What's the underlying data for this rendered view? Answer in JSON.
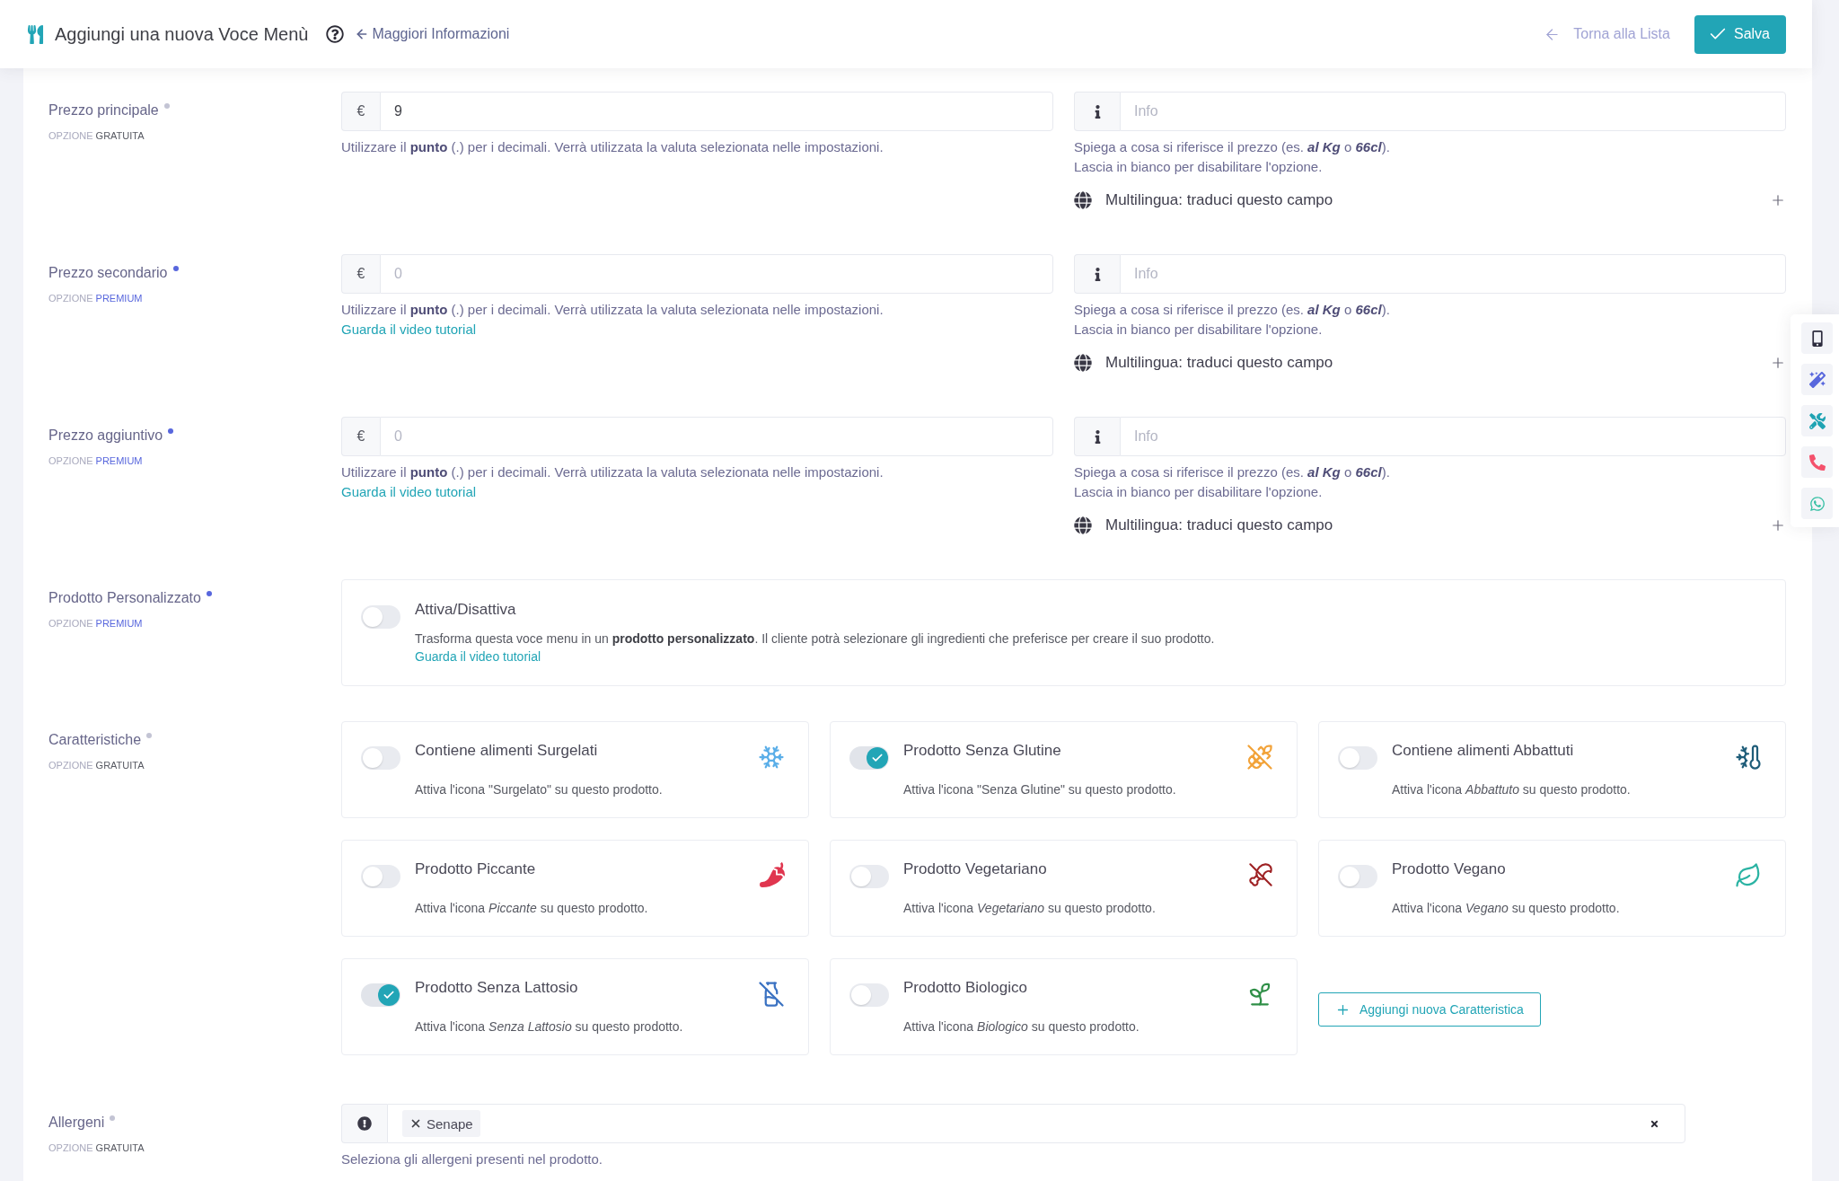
{
  "header": {
    "title": "Aggiungi una nuova Voce Menù",
    "info_link": "Maggiori Informazioni",
    "back_link": "Torna alla Lista",
    "save_button": "Salva"
  },
  "price_rows": [
    {
      "label": "Prezzo principale",
      "option_prefix": "OPZIONE",
      "tier": "GRATUITA",
      "premium": false,
      "currency": "€",
      "price": {
        "value": "9"
      },
      "price_help": "Utilizzare il **punto** (.) per i decimali. Verrà utilizzata la valuta selezionata nelle impostazioni.",
      "info_placeholder": "Info",
      "info_help": [
        "Spiega a cosa si riferisce il prezzo (es. **al Kg** o **66cl**).",
        "Lascia in bianco per disabilitare l'opzione."
      ],
      "translate": {
        "label": "Multilingua: traduci questo campo",
        "expanded": false
      }
    },
    {
      "label": "Prezzo secondario",
      "option_prefix": "OPZIONE",
      "tier": "PREMIUM",
      "premium": true,
      "currency": "€",
      "price": {
        "placeholder": "0"
      },
      "price_help": "Utilizzare il **punto** (.) per i decimali. Verrà utilizzata la valuta selezionata nelle impostazioni.",
      "video_link": "Guarda il video tutorial",
      "info_placeholder": "Info",
      "info_help": [
        "Spiega a cosa si riferisce il prezzo (es. **al Kg** o **66cl**).",
        "Lascia in bianco per disabilitare l'opzione."
      ],
      "translate": {
        "label": "Multilingua: traduci questo campo",
        "expanded": false
      }
    },
    {
      "label": "Prezzo aggiuntivo",
      "option_prefix": "OPZIONE",
      "tier": "PREMIUM",
      "premium": true,
      "currency": "€",
      "price": {
        "placeholder": "0"
      },
      "price_help": "Utilizzare il **punto** (.) per i decimali. Verrà utilizzata la valuta selezionata nelle impostazioni.",
      "video_link": "Guarda il video tutorial",
      "info_placeholder": "Info",
      "info_help": [
        "Spiega a cosa si riferisce il prezzo (es. **al Kg** o **66cl**).",
        "Lascia in bianco per disabilitare l'opzione."
      ],
      "translate": {
        "label": "Multilingua: traduci questo campo",
        "expanded": false
      }
    }
  ],
  "custom_product": {
    "label": "Prodotto Personalizzato",
    "option_prefix": "OPZIONE",
    "tier": "PREMIUM",
    "premium": true,
    "toggle": {
      "label": "Attiva/Disattiva",
      "on": false
    },
    "description": "Trasforma questa voce menu in un **prodotto personalizzato**. Il cliente potrà selezionare gli ingredienti che preferisce per creare il suo prodotto.",
    "video_link": "Guarda il video tutorial"
  },
  "features": {
    "label": "Caratteristiche",
    "option_prefix": "OPZIONE",
    "tier": "GRATUITA",
    "premium": false,
    "items": [
      {
        "title": "Contiene alimenti Surgelati",
        "description": "Attiva l'icona \"Surgelato\" su questo prodotto.",
        "on": false,
        "color": "#5aaee8"
      },
      {
        "title": "Prodotto Senza Glutine",
        "description": "Attiva l'icona \"Senza Glutine\" su questo prodotto.",
        "on": true,
        "color": "#f2a33a"
      },
      {
        "title": "Contiene alimenti Abbattuti",
        "description": "Attiva l'icona *Abbattuto* su questo prodotto.",
        "on": false,
        "color": "#1f5d79"
      },
      {
        "title": "Prodotto Piccante",
        "description": "Attiva l'icona *Piccante* su questo prodotto.",
        "on": false,
        "color": "#e0364f"
      },
      {
        "title": "Prodotto Vegetariano",
        "description": "Attiva l'icona *Vegetariano* su questo prodotto.",
        "on": false,
        "color": "#9e2224"
      },
      {
        "title": "Prodotto Vegano",
        "description": "Attiva l'icona *Vegano* su questo prodotto.",
        "on": false,
        "color": "#2ab3a3"
      },
      {
        "title": "Prodotto Senza Lattosio",
        "description": "Attiva l'icona *Senza Lattosio* su questo prodotto.",
        "on": true,
        "color": "#3b72c2"
      },
      {
        "title": "Prodotto Biologico",
        "description": "Attiva l'icona *Biologico* su questo prodotto.",
        "on": false,
        "color": "#2f8f47"
      }
    ],
    "add_button": "Aggiungi nuova Caratteristica"
  },
  "allergens": {
    "label": "Allergeni",
    "option_prefix": "OPZIONE",
    "tier": "GRATUITA",
    "premium": false,
    "tags": [
      "Senape"
    ],
    "help": "Seleziona gli allergeni presenti nel prodotto."
  }
}
